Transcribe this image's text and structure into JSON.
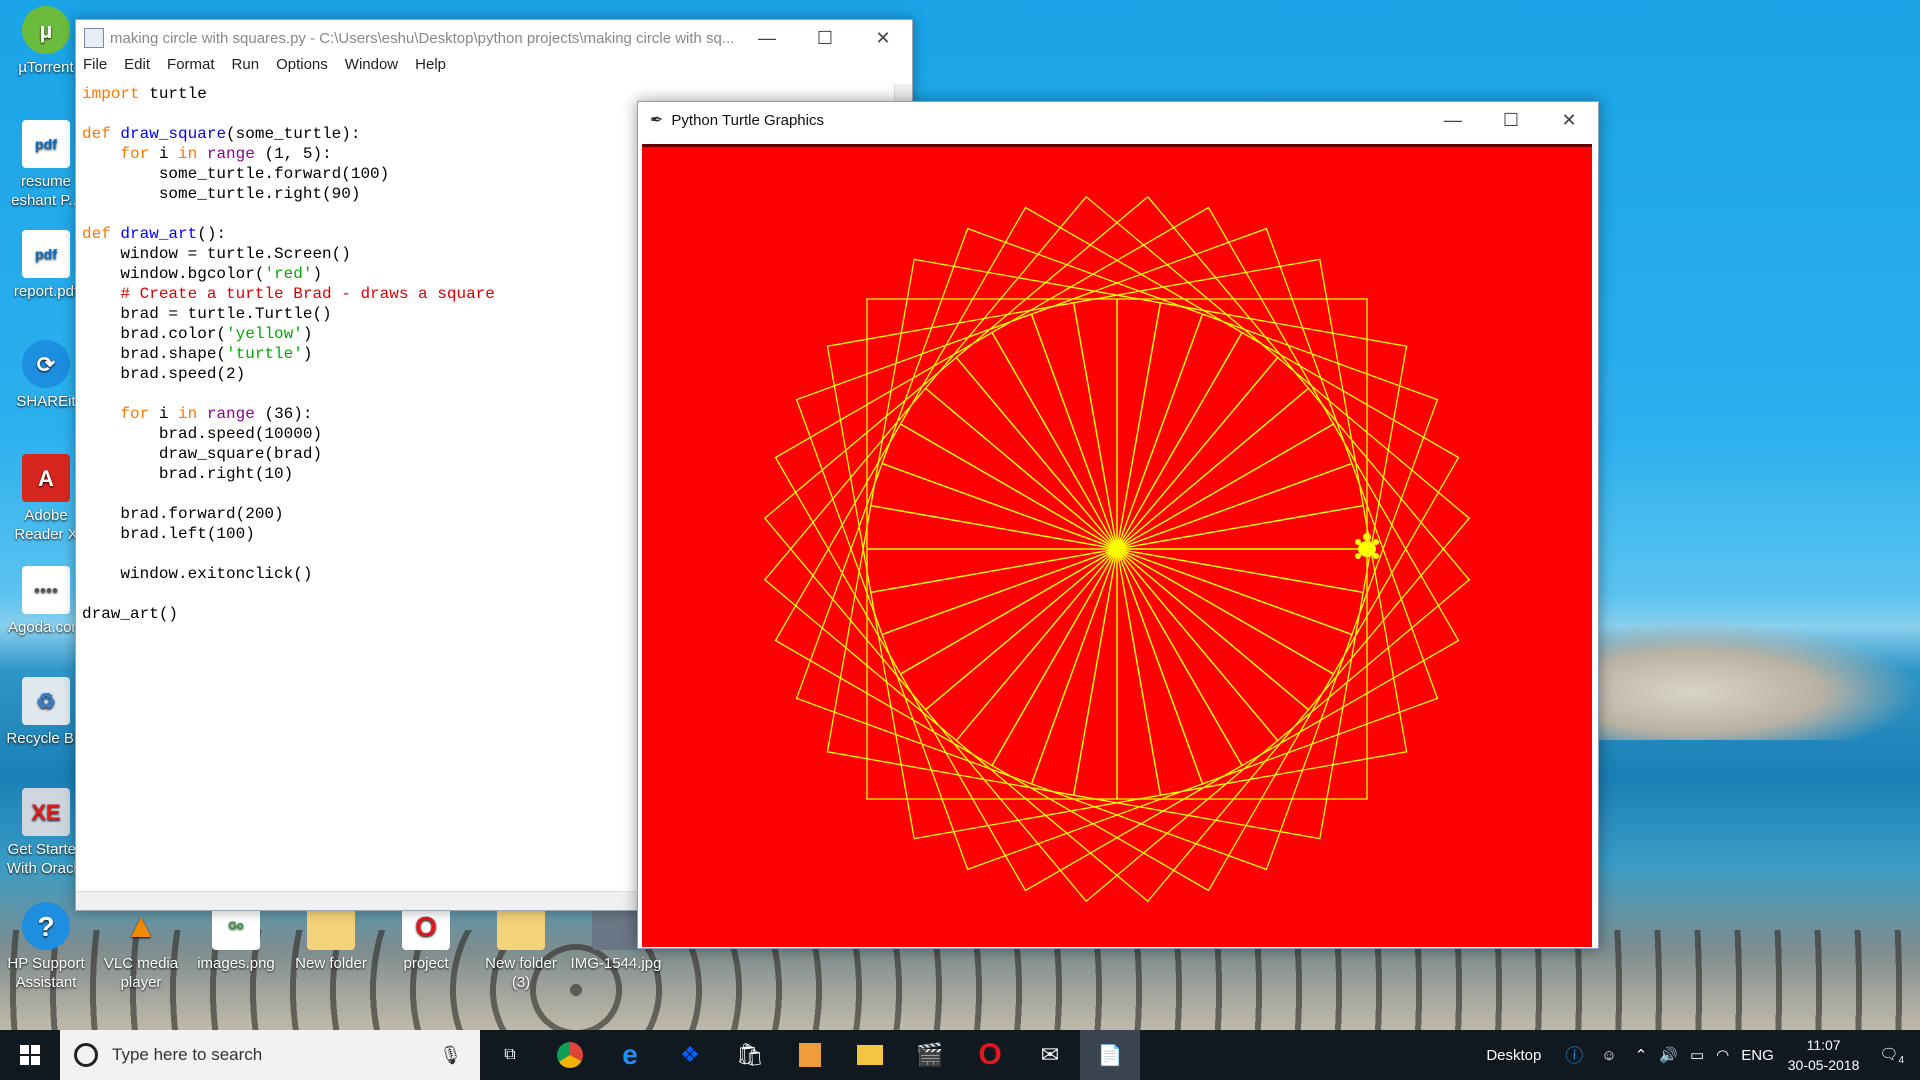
{
  "desktop_icons": [
    {
      "label": "µTorrent"
    },
    {
      "label": "resume eshant P..."
    },
    {
      "label": "report.pdf"
    },
    {
      "label": "SHAREit"
    },
    {
      "label": "Adobe Reader X"
    },
    {
      "label": "Agoda.com"
    },
    {
      "label": "Recycle Bin"
    },
    {
      "label": "Get Started With Oracle"
    },
    {
      "label": "HP Support Assistant"
    },
    {
      "label": "VLC media player"
    },
    {
      "label": "images.png"
    },
    {
      "label": "New folder"
    },
    {
      "label": "project"
    },
    {
      "label": "New folder (3)"
    },
    {
      "label": "IMG-1544.jpg"
    }
  ],
  "editor": {
    "title": "making circle with squares.py - C:\\Users\\eshu\\Desktop\\python projects\\making circle with sq...",
    "menu": [
      "File",
      "Edit",
      "Format",
      "Run",
      "Options",
      "Window",
      "Help"
    ]
  },
  "turtle_window": {
    "title": "Python Turtle Graphics",
    "bg_color": "#ff0000",
    "pen_color": "#ffff00"
  },
  "taskbar": {
    "search_placeholder": "Type here to search",
    "desktop_label": "Desktop",
    "language": "ENG",
    "time": "11:07",
    "date": "30-05-2018",
    "notification_count": "4"
  }
}
